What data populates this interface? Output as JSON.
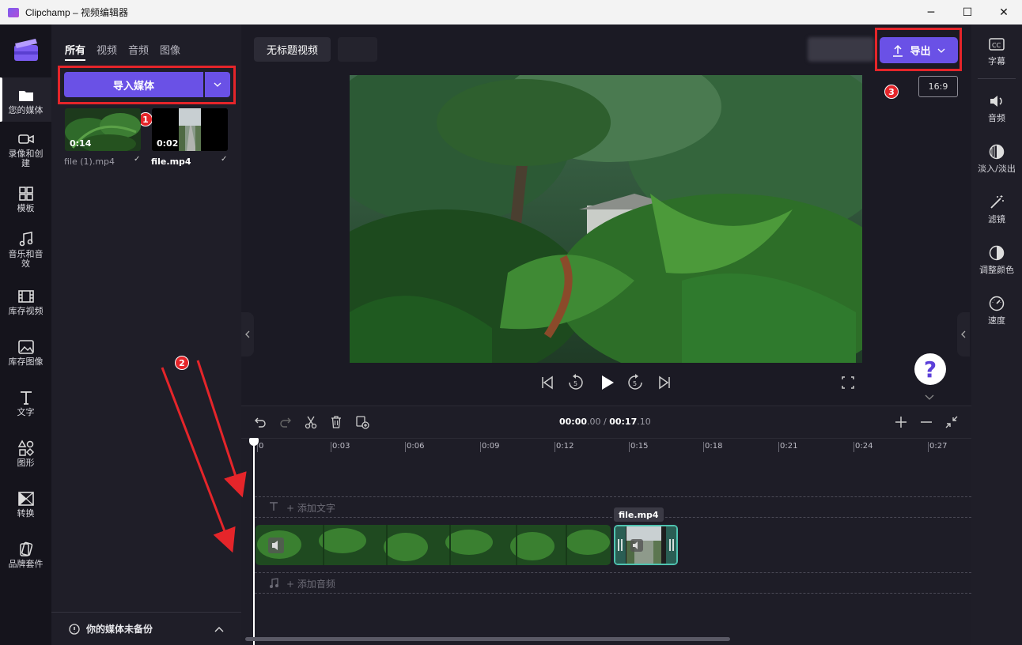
{
  "window": {
    "title": "Clipchamp – 视频编辑器",
    "minimize": "─",
    "maximize": "☐",
    "close": "✕"
  },
  "leftnav": {
    "items": [
      {
        "label": "您的媒体",
        "icon": "folder-icon"
      },
      {
        "label": "录像和创建",
        "icon": "camera-icon"
      },
      {
        "label": "模板",
        "icon": "templates-icon"
      },
      {
        "label": "音乐和音效",
        "icon": "music-icon"
      },
      {
        "label": "库存视频",
        "icon": "film-icon"
      },
      {
        "label": "库存图像",
        "icon": "image-icon"
      },
      {
        "label": "文字",
        "icon": "text-icon"
      },
      {
        "label": "图形",
        "icon": "shapes-icon"
      },
      {
        "label": "转换",
        "icon": "transition-icon"
      },
      {
        "label": "品牌套件",
        "icon": "brand-icon"
      }
    ]
  },
  "media": {
    "tabs": [
      "所有",
      "视频",
      "音频",
      "图像"
    ],
    "import_label": "导入媒体",
    "files": [
      {
        "name": "file (1).mp4",
        "duration": "0:14"
      },
      {
        "name": "file.mp4",
        "duration": "0:02"
      }
    ],
    "footer": "你的媒体未备份"
  },
  "toolbar": {
    "project_title": "无标题视频",
    "export_label": "导出",
    "aspect_ratio": "16:9"
  },
  "annotations": {
    "step1": "1",
    "step2": "2",
    "step3": "3"
  },
  "rightnav": {
    "items": [
      {
        "label": "字幕",
        "icon": "cc-icon"
      },
      {
        "label": "音频",
        "icon": "speaker-icon"
      },
      {
        "label": "淡入/淡出",
        "icon": "fade-icon"
      },
      {
        "label": "滤镜",
        "icon": "wand-icon"
      },
      {
        "label": "调整颜色",
        "icon": "contrast-icon"
      },
      {
        "label": "速度",
        "icon": "speed-icon"
      }
    ]
  },
  "help_label": "?",
  "timeline": {
    "time_current_main": "00:00",
    "time_current_frac": ".00",
    "separator": " / ",
    "time_total_main": "00:17",
    "time_total_frac": ".10",
    "ticks": [
      "0",
      "0:03",
      "0:06",
      "0:09",
      "0:12",
      "0:15",
      "0:18",
      "0:21",
      "0:24",
      "0:27"
    ],
    "add_text": "+ 添加文字",
    "add_audio": "+ 添加音频",
    "clip_tooltip": "file.mp4"
  },
  "colors": {
    "accent": "#6a51e6",
    "annotation": "#e5252a",
    "selection": "#4fc3b0"
  }
}
